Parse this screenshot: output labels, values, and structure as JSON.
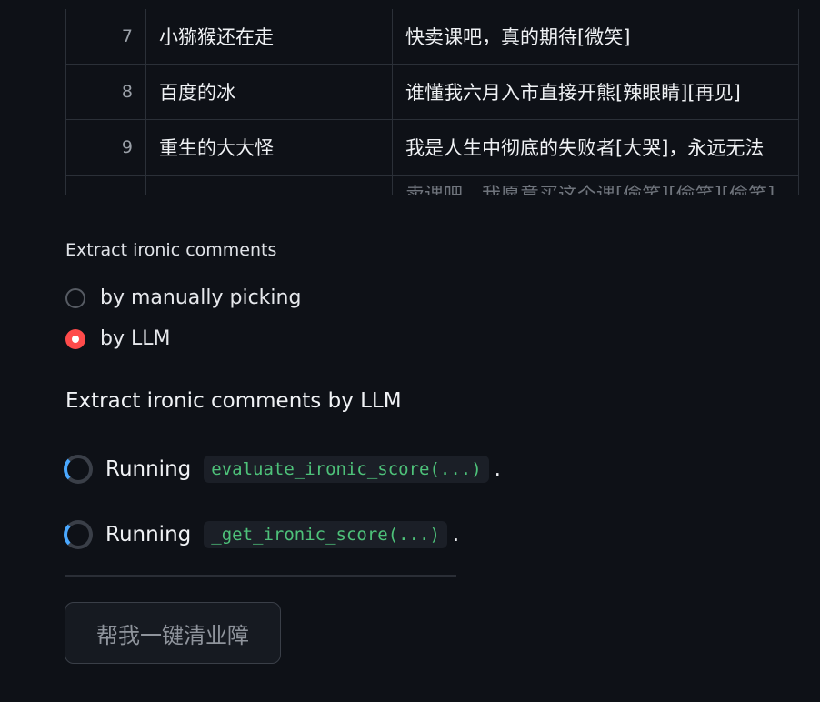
{
  "table": {
    "rows": [
      {
        "index": "7",
        "user": "小猕猴还在走",
        "comment": "快卖课吧，真的期待[微笑]"
      },
      {
        "index": "8",
        "user": "百度的冰",
        "comment": "谁懂我六月入市直接开熊[辣眼睛][再见]"
      },
      {
        "index": "9",
        "user": "重生的大大怪",
        "comment": "我是人生中彻底的失败者[大哭]，永远无法"
      },
      {
        "index": "",
        "user": "",
        "comment": "卖课吧，我愿意买这个课[偷笑][偷笑][偷笑]"
      }
    ]
  },
  "extract_section": {
    "label": "Extract ironic comments",
    "options": [
      {
        "label": "by manually picking",
        "checked": false
      },
      {
        "label": "by LLM",
        "checked": true
      }
    ]
  },
  "llm_section": {
    "title": "Extract ironic comments by LLM",
    "statuses": [
      {
        "prefix": "Running",
        "code": "evaluate_ironic_score(...)",
        "suffix": "."
      },
      {
        "prefix": "Running",
        "code": "_get_ironic_score(...)",
        "suffix": "."
      }
    ]
  },
  "action_button": {
    "label": "帮我一键清业障"
  },
  "colors": {
    "background": "#0e1117",
    "accent": "#ff4b4b",
    "code_text": "#4ec27a",
    "spinner": "#4aa8ff"
  },
  "icons": {
    "spinner": "loading-spinner-icon"
  }
}
